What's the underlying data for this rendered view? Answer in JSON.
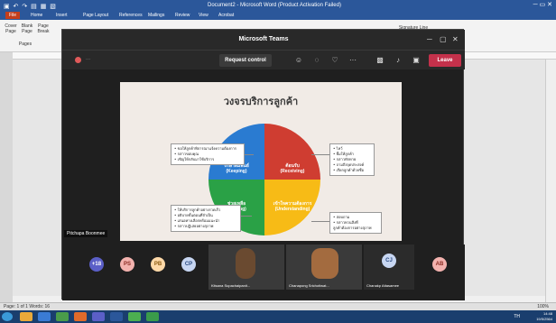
{
  "word": {
    "title": "Document2 - Microsoft Word (Product Activation Failed)",
    "tabs": [
      "File",
      "Home",
      "Insert",
      "Page Layout",
      "References",
      "Mailings",
      "Review",
      "View",
      "Acrobat"
    ],
    "ribbon": {
      "cover_page": "Cover Page",
      "blank_page": "Blank Page",
      "page_break": "Page Break",
      "pages_group": "Pages",
      "signature_line": "Signature Line"
    },
    "status": {
      "left": "Page: 1 of 1   Words: 16",
      "right": "100%"
    }
  },
  "teams": {
    "title": "Microsoft Teams",
    "request_control": "Request control",
    "leave": "Leave",
    "presenter_name": "Pitchapa Boonmee",
    "participants": {
      "overflow": "+18",
      "avatars": [
        {
          "initials": "PS",
          "color": "#f3b2ae"
        },
        {
          "initials": "PB",
          "color": "#ffd9a8"
        },
        {
          "initials": "CP",
          "color": "#c7d6f2"
        }
      ],
      "tiles": [
        {
          "name": "Kitsana Supachaipanit..."
        },
        {
          "name": "Chanapong Srichotiwat..."
        },
        {
          "name": "Chanakp Attasamee"
        }
      ],
      "more": [
        {
          "initials": "CJ",
          "color": "#c7d6f2"
        },
        {
          "initials": "AB",
          "color": "#f3b2ae"
        }
      ]
    }
  },
  "slide": {
    "title": "วงจรบริการลูกค้า",
    "quadrants": [
      {
        "th": "รักษาสัมพันธ์",
        "en": "(Keeping)",
        "color": "#2a7bd1"
      },
      {
        "th": "ต้อนรับ",
        "en": "(Receiving)",
        "color": "#cf3d31"
      },
      {
        "th": "ช่วยเหลือ",
        "en": "(Helping)",
        "color": "#2aa146"
      },
      {
        "th": "เข้าใจความต้องการ",
        "en": "(Understanding)",
        "color": "#f7bb16"
      }
    ],
    "boxes": {
      "keeping": [
        "• ขอให้ลูกค้าพิจารณาแจ้งความต้องการ",
        "• กล่าวขอบคุณ",
        "• เชิญให้กลับมาใช้บริการ"
      ],
      "receiving": [
        "• ไหว้",
        "• ยิ้มให้ลูกค้า",
        "• กล่าวทักทาย",
        "• ถามถึงจุดประสงค์",
        "• เรียกลูกค้าด้วยชื่อ"
      ],
      "helping": [
        "• ให้บริการลูกค้าอย่างรวดเร็ว",
        "• อธิบายขั้นตอนที่จำเป็น",
        "• เสนอทางเลือกพร้อมแนะนำ",
        "• กล่าวปฏิเสธอย่างสุภาพ"
      ],
      "understanding": [
        "• สอบถาม",
        "• กล่าวทวนสิ่งที่",
        "  ลูกค้าต้องการอย่างสุภาพ"
      ]
    }
  },
  "taskbar": {
    "time": "14:48",
    "date": "19/5/2564",
    "lang": "TH"
  }
}
